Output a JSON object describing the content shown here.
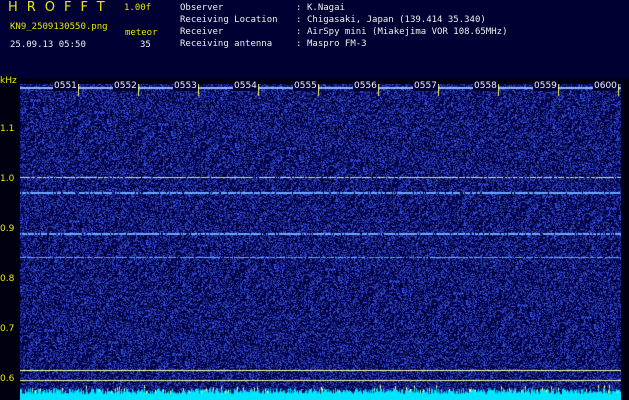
{
  "header": {
    "app_title": "HROFFT",
    "version": "1.00f",
    "filename": "KN9_2509130550.png",
    "timestamp": "25.09.13 05:50",
    "meteor_label": "meteor",
    "meteor_count": "35",
    "info_labels": [
      "Observer",
      "Receiving Location",
      "Receiver",
      "Receiving antenna"
    ],
    "info_values": [
      "K.Nagai",
      "Chigasaki, Japan (139.414 35.340)",
      "AirSpy mini (Miakejima VOR 108.65MHz)",
      "Maspro FM-3"
    ],
    "separator": ":"
  },
  "axis": {
    "unit": "kHz",
    "y_ticks": [
      "1.1",
      "1.0",
      "0.9",
      "0.8",
      "0.7",
      "0.6"
    ],
    "time_ticks": [
      "0551",
      "0552",
      "0553",
      "0554",
      "0555",
      "0556",
      "0557",
      "0558",
      "0559",
      "0600"
    ]
  },
  "colors": {
    "header_bg": "#000033",
    "label_yellow": "#e8e800",
    "text_white": "#f0f0f0",
    "signal_line": "#6fa8ff",
    "noise_floor": "#00e5ff",
    "marker_yellow": "#ffff66"
  }
}
